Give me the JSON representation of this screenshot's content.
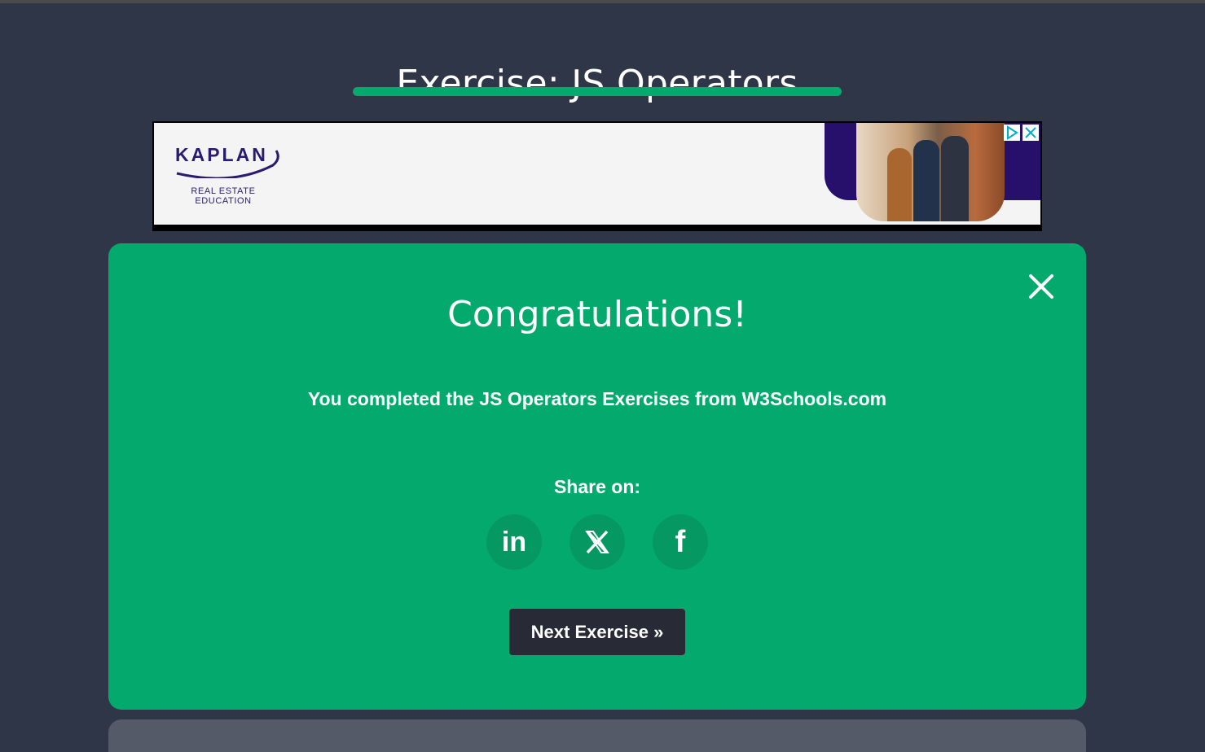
{
  "page": {
    "title": "Exercise: JS Operators",
    "accent_color": "#04aa6d",
    "background_color": "#2f3647"
  },
  "ad": {
    "brand": "KAPLAN",
    "subtitle_line1": "REAL ESTATE",
    "subtitle_line2": "EDUCATION",
    "adchoices_icon": "adchoices-icon",
    "close_icon": "close-icon"
  },
  "modal": {
    "heading": "Congratulations!",
    "message": "You completed the JS Operators Exercises from W3Schools.com",
    "share_label": "Share on:",
    "share_buttons": [
      {
        "icon": "linkedin-icon",
        "label": "in"
      },
      {
        "icon": "x-icon",
        "label": "X"
      },
      {
        "icon": "facebook-icon",
        "label": "f"
      }
    ],
    "next_button_label": "Next Exercise »",
    "close_icon": "close-icon",
    "next_button_color": "#282a35"
  }
}
